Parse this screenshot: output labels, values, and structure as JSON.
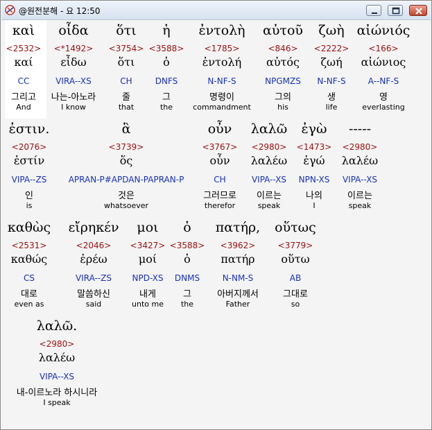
{
  "window": {
    "title": "@원전분해 - 요 12:50",
    "icons": {
      "app": "app-logo-icon",
      "minimize": "minimize-icon",
      "maximize": "maximize-icon",
      "close": "close-icon"
    }
  },
  "rows": [
    {
      "words": [
        {
          "greek": "καὶ",
          "strong": "<2532>",
          "lemma": "καί",
          "parse": "CC",
          "korean": "그리고",
          "english": "And"
        },
        {
          "greek": "οἶδα",
          "strong": "<*1492>",
          "lemma": "εἶδω",
          "parse": "VIRA--XS",
          "korean": "나는-아노라",
          "english": "I know"
        },
        {
          "greek": "ὅτι",
          "strong": "<3754>",
          "lemma": "ὅτι",
          "parse": "CH",
          "korean": "줄",
          "english": "that"
        },
        {
          "greek": "ἡ",
          "strong": "<3588>",
          "lemma": "ὁ",
          "parse": "DNFS",
          "korean": "그",
          "english": "the"
        },
        {
          "greek": "ἐντολὴ",
          "strong": "<1785>",
          "lemma": "ἐντολή",
          "parse": "N-NF-S",
          "korean": "명령이",
          "english": "commandment"
        },
        {
          "greek": "αὐτοῦ",
          "strong": "<846>",
          "lemma": "αὐτός",
          "parse": "NPGMZS",
          "korean": "그의",
          "english": "his"
        },
        {
          "greek": "ζωὴ",
          "strong": "<2222>",
          "lemma": "ζωή",
          "parse": "N-NF-S",
          "korean": "생",
          "english": "life"
        },
        {
          "greek": "αἰώνιός",
          "strong": "<166>",
          "lemma": "αἰώνιος",
          "parse": "A--NF-S",
          "korean": "영",
          "english": "everlasting"
        }
      ]
    },
    {
      "words": [
        {
          "greek": "ἐστιν.",
          "strong": "<2076>",
          "lemma": "ἐστίν",
          "parse": "VIPA--ZS",
          "korean": "인",
          "english": "is"
        },
        {
          "greek": "ἃ",
          "strong": "<3739>",
          "lemma": "ὅς",
          "parse": "APRAN-P#APDAN-PAPRAN-P",
          "korean": "것은",
          "english": "whatsoever"
        },
        {
          "greek": "οὖν",
          "strong": "<3767>",
          "lemma": "οὖν",
          "parse": "CH",
          "korean": "그러므로",
          "english": "therefor"
        },
        {
          "greek": "λαλῶ",
          "strong": "<2980>",
          "lemma": "λαλέω",
          "parse": "VIPA--XS",
          "korean": "이르는",
          "english": "speak"
        },
        {
          "greek": "ἐγὼ",
          "strong": "<1473>",
          "lemma": "ἐγώ",
          "parse": "NPN-XS",
          "korean": "나의",
          "english": "I"
        },
        {
          "greek": "-----",
          "strong": "<2980>",
          "lemma": "λαλέω",
          "parse": "VIPA--XS",
          "korean": "이르는",
          "english": "speak"
        }
      ]
    },
    {
      "words": [
        {
          "greek": "καθὼς",
          "strong": "<2531>",
          "lemma": "καθώς",
          "parse": "CS",
          "korean": "대로",
          "english": "even as"
        },
        {
          "greek": "εἴρηκέν",
          "strong": "<2046>",
          "lemma": "ἐρέω",
          "parse": "VIRA--ZS",
          "korean": "말씀하신",
          "english": "said"
        },
        {
          "greek": "μοι",
          "strong": "<3427>",
          "lemma": "μοί",
          "parse": "NPD-XS",
          "korean": "내게",
          "english": "unto me"
        },
        {
          "greek": "ὁ",
          "strong": "<3588>",
          "lemma": "ὁ",
          "parse": "DNMS",
          "korean": "그",
          "english": "the"
        },
        {
          "greek": "πατήρ,",
          "strong": "<3962>",
          "lemma": "πατήρ",
          "parse": "N-NM-S",
          "korean": "아버지께서",
          "english": "Father"
        },
        {
          "greek": "οὕτως",
          "strong": "<3779>",
          "lemma": "οὕτω",
          "parse": "AB",
          "korean": "그대로",
          "english": "so"
        }
      ]
    },
    {
      "words": [
        {
          "greek": "λαλῶ.",
          "strong": "<2980>",
          "lemma": "λαλέω",
          "parse": "VIPA--XS",
          "korean": "내-이르노라 하시니라",
          "english": "I speak"
        }
      ]
    }
  ]
}
